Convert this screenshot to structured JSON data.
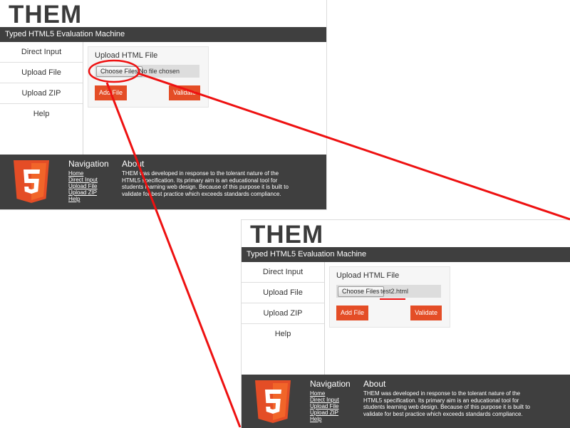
{
  "shots": [
    {
      "logo": "THEM",
      "subtitle": "Typed HTML5 Evaluation Machine",
      "sidebar": [
        "Direct Input",
        "Upload File",
        "Upload ZIP",
        "Help"
      ],
      "panel": {
        "title": "Upload HTML File",
        "choose_label": "Choose Files",
        "file_status": "No file chosen",
        "add_label": "Add File",
        "validate_label": "Validate"
      },
      "footer": {
        "nav_heading": "Navigation",
        "nav_links": [
          "Home",
          "Direct Input",
          "Upload File",
          "Upload ZIP",
          "Help"
        ],
        "about_heading": "About",
        "about_text": "THEM was developed in response to the tolerant nature of the HTML5 specification. Its primary aim is an educational tool for students learning web design. Because of this purpose it is built to validate for best practice which exceeds standards compliance."
      }
    },
    {
      "logo": "THEM",
      "subtitle": "Typed HTML5 Evaluation Machine",
      "sidebar": [
        "Direct Input",
        "Upload File",
        "Upload ZIP",
        "Help"
      ],
      "panel": {
        "title": "Upload HTML File",
        "choose_label": "Choose Files",
        "file_status": "test2.html",
        "add_label": "Add File",
        "validate_label": "Validate"
      },
      "footer": {
        "nav_heading": "Navigation",
        "nav_links": [
          "Home",
          "Direct Input",
          "Upload File",
          "Upload ZIP",
          "Help"
        ],
        "about_heading": "About",
        "about_text": "THEM was developed in response to the tolerant nature of the HTML5 specification. Its primary aim is an educational tool for students learning web design. Because of this purpose it is built to validate for best practice which exceeds standards compliance."
      }
    }
  ],
  "colors": {
    "header_bar": "#3f3f3f",
    "accent_button": "#e44d26",
    "annotation": "#ee1111",
    "html5_logo_dark": "#e44d26",
    "html5_logo_light": "#f16529"
  },
  "icons": {
    "footer_logo": "html5-logo-icon"
  }
}
